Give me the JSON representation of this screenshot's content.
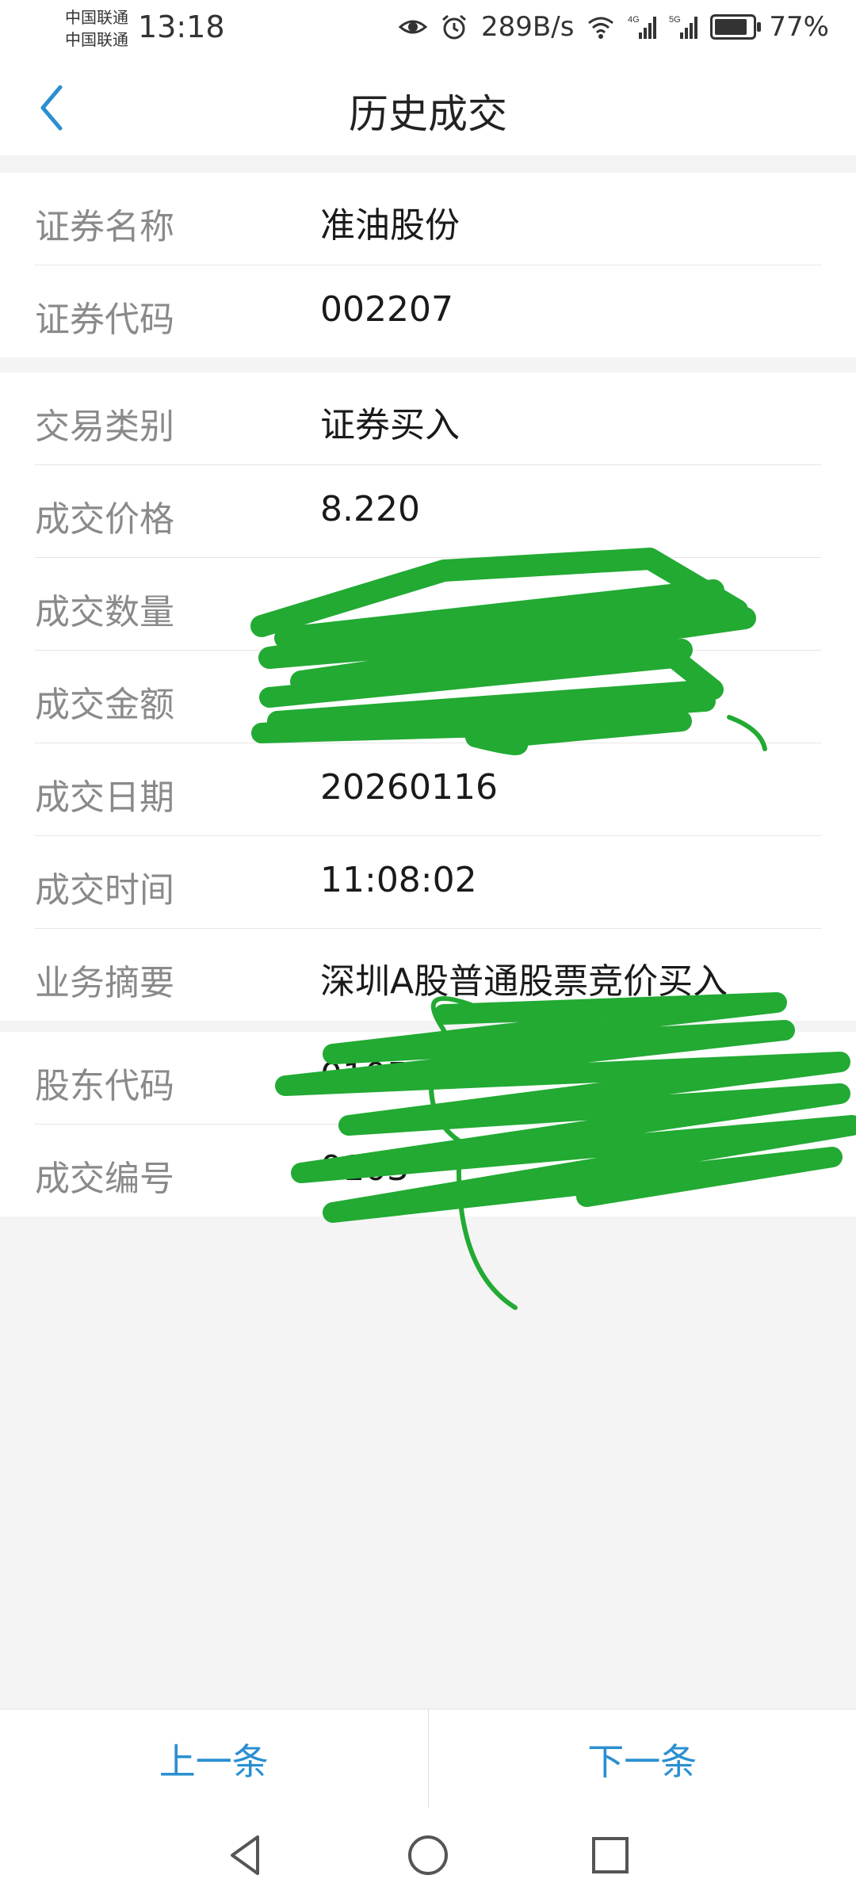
{
  "status_bar": {
    "carrier_1": "中国联通",
    "carrier_2": "中国联通",
    "time": "13:18",
    "net_speed": "289B/s",
    "battery": "77%",
    "icons": [
      "eye-icon",
      "alarm-icon",
      "wifi-icon",
      "signal-4g-icon",
      "signal-5g-icon",
      "battery-icon"
    ]
  },
  "header": {
    "title": "历史成交",
    "back_icon": "chevron-left-icon",
    "accent_color": "#2a8fd0"
  },
  "section_security": [
    {
      "label": "证券名称",
      "value": "准油股份"
    },
    {
      "label": "证券代码",
      "value": "002207"
    }
  ],
  "section_trade": [
    {
      "label": "交易类别",
      "value": "证券买入"
    },
    {
      "label": "成交价格",
      "value": "8.220"
    },
    {
      "label": "成交数量",
      "value": ""
    },
    {
      "label": "成交金额",
      "value": ""
    },
    {
      "label": "成交日期",
      "value": "20260116"
    },
    {
      "label": "成交时间",
      "value": "11:08:02"
    },
    {
      "label": "业务摘要",
      "value": "深圳A股普通股票竞价买入"
    }
  ],
  "section_account": [
    {
      "label": "股东代码",
      "value": "0105"
    },
    {
      "label": "成交编号",
      "value": "0103"
    }
  ],
  "footer": {
    "prev_label": "上一条",
    "next_label": "下一条"
  },
  "navigation": {
    "icons": [
      "back-triangle-icon",
      "home-circle-icon",
      "recents-square-icon"
    ]
  },
  "redaction_color": "#22aa33"
}
